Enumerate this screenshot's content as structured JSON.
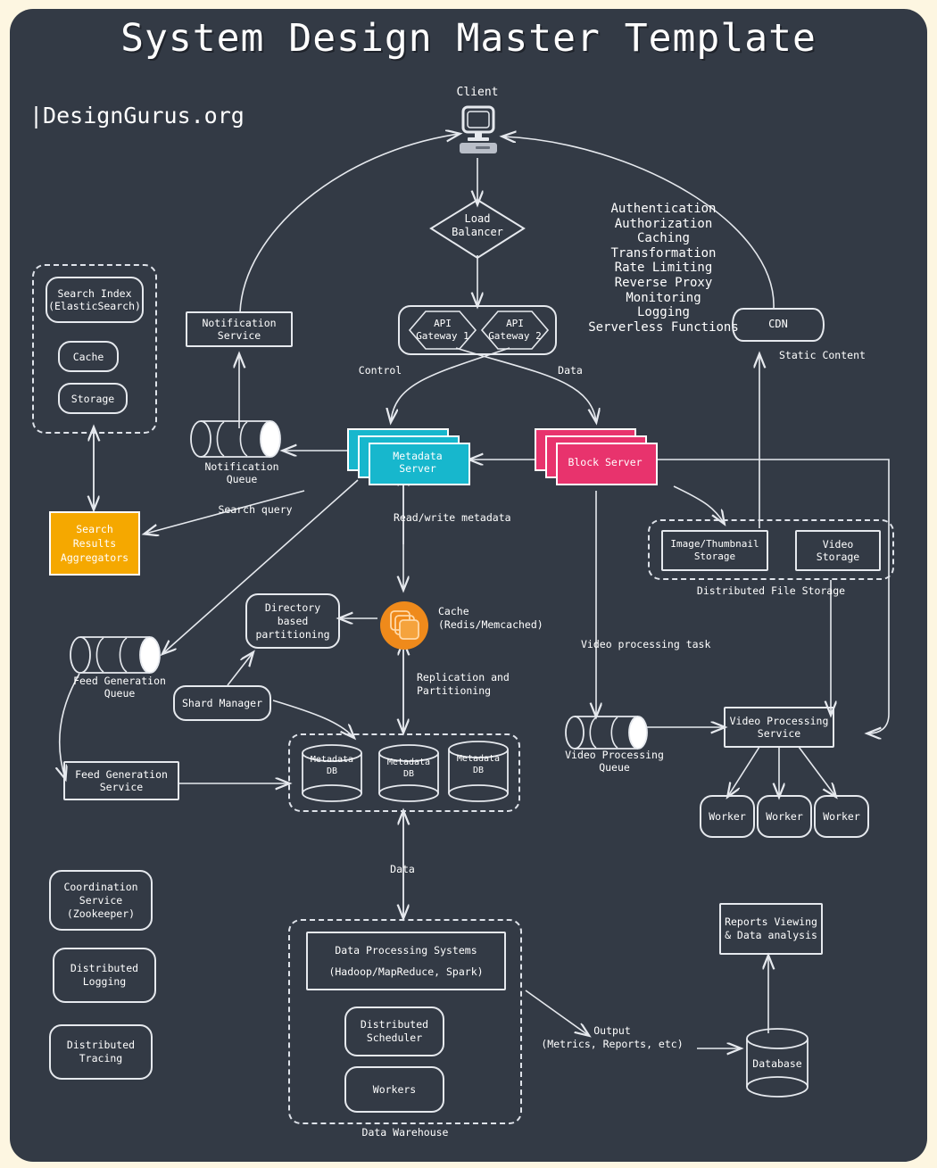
{
  "page": {
    "title": "System Design Master Template",
    "brand": "|DesignGurus.org",
    "bg_outer": "#fdf6e1",
    "bg_panel": "#333a45",
    "stroke": "#e6e9ee",
    "accent_teal": "#17b7cd",
    "accent_pink": "#e8336d",
    "accent_amber": "#f5a800",
    "accent_orange": "#ef8a1b"
  },
  "nodes": {
    "client": "Client",
    "load_balancer": "Load\nBalancer",
    "api_gateway_1": "API\nGateway 1",
    "api_gateway_2": "API\nGateway 2",
    "cdn": "CDN",
    "notification_service": "Notification\nService",
    "notification_queue": "Notification\nQueue",
    "search_index": "Search Index\n(ElasticSearch)",
    "search_cache": "Cache",
    "search_storage": "Storage",
    "search_results_aggregators": "Search\nResults\nAggregators",
    "metadata_server": "Metadata\nServer",
    "block_server": "Block Server",
    "image_thumbnail_storage": "Image/Thumbnail\nStorage",
    "video_storage": "Video\nStorage",
    "distributed_file_storage": "Distributed File Storage",
    "directory_based_partitioning": "Directory\nbased\npartitioning",
    "cache_label": "Cache\n(Redis/Memcached)",
    "shard_manager": "Shard Manager",
    "feed_generation_queue": "Feed Generation\nQueue",
    "feed_generation_service": "Feed Generation\nService",
    "metadata_db_1": "Metadata\nDB",
    "metadata_db_2": "Metadata\nDB",
    "metadata_db_3": "Metadata\nDB",
    "video_processing_queue": "Video Processing\nQueue",
    "video_processing_service": "Video Processing\nService",
    "worker_1": "Worker",
    "worker_2": "Worker",
    "worker_3": "Worker",
    "coordination_service": "Coordination\nService\n(Zookeeper)",
    "distributed_logging": "Distributed\nLogging",
    "distributed_tracing": "Distributed\nTracing",
    "data_processing_systems": "Data Processing Systems",
    "data_processing_systems_sub": "(Hadoop/MapReduce, Spark)",
    "distributed_scheduler": "Distributed\nScheduler",
    "dw_workers": "Workers",
    "data_warehouse": "Data Warehouse",
    "reports_viewing": "Reports Viewing\n& Data analysis",
    "database": "Database"
  },
  "gateway_features": [
    "Authentication",
    "Authorization",
    "Caching",
    "Transformation",
    "Rate Limiting",
    "Reverse Proxy",
    "Monitoring",
    "Logging",
    "Serverless Functions"
  ],
  "edge_labels": {
    "control": "Control",
    "data_top": "Data",
    "static_content": "Static Content",
    "search_query": "Search query",
    "read_write_metadata": "Read/write metadata",
    "replication_partitioning": "Replication and\nPartitioning",
    "video_processing_task": "Video processing task",
    "data_bottom": "Data",
    "output": "Output\n(Metrics, Reports, etc)"
  }
}
